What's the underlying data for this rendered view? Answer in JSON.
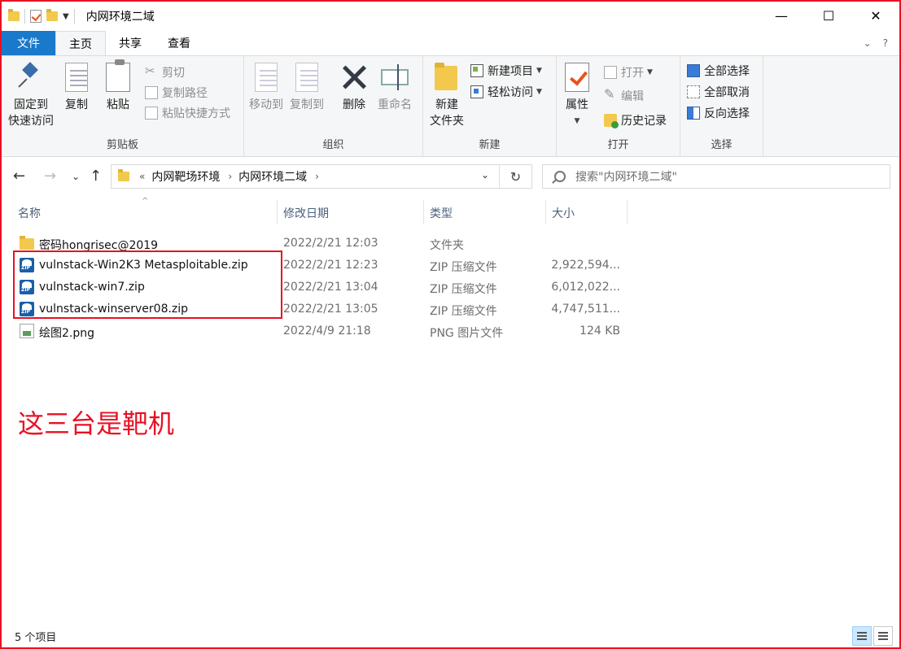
{
  "window": {
    "title": "内网环境二域",
    "minimize": "—",
    "maximize": "☐",
    "close": "✕"
  },
  "tabs": {
    "file": "文件",
    "home": "主页",
    "share": "共享",
    "view": "查看"
  },
  "ribbon": {
    "clipboard": {
      "label": "剪贴板",
      "pin": "固定到\n快速访问",
      "pin_line1": "固定到",
      "pin_line2": "快速访问",
      "copy": "复制",
      "paste": "粘贴",
      "cut": "剪切",
      "copy_path": "复制路径",
      "paste_shortcut": "粘贴快捷方式"
    },
    "organize": {
      "label": "组织",
      "move_to": "移动到",
      "copy_to": "复制到",
      "delete": "删除",
      "rename": "重命名"
    },
    "new": {
      "label": "新建",
      "new_folder_line1": "新建",
      "new_folder_line2": "文件夹",
      "new_item": "新建项目",
      "easy_access": "轻松访问"
    },
    "open": {
      "label": "打开",
      "properties": "属性",
      "open": "打开",
      "edit": "编辑",
      "history": "历史记录"
    },
    "select": {
      "label": "选择",
      "select_all": "全部选择",
      "select_none": "全部取消",
      "invert": "反向选择"
    }
  },
  "address": {
    "crumbs": [
      "内网靶场环境",
      "内网环境二域"
    ],
    "overflow": "«",
    "search_placeholder": "搜索\"内网环境二域\""
  },
  "columns": {
    "name": "名称",
    "date": "修改日期",
    "type": "类型",
    "size": "大小"
  },
  "files": [
    {
      "name": "密码hongrisec@2019",
      "date": "2022/2/21 12:03",
      "type": "文件夹",
      "size": "",
      "icon": "folder-icon"
    },
    {
      "name": "vulnstack-Win2K3 Metasploitable.zip",
      "date": "2022/2/21 12:23",
      "type": "ZIP 压缩文件",
      "size": "2,922,594...",
      "icon": "zip-icon"
    },
    {
      "name": "vulnstack-win7.zip",
      "date": "2022/2/21 13:04",
      "type": "ZIP 压缩文件",
      "size": "6,012,022...",
      "icon": "zip-icon"
    },
    {
      "name": "vulnstack-winserver08.zip",
      "date": "2022/2/21 13:05",
      "type": "ZIP 压缩文件",
      "size": "4,747,511...",
      "icon": "zip-icon"
    },
    {
      "name": "绘图2.png",
      "date": "2022/4/9 21:18",
      "type": "PNG 图片文件",
      "size": "124 KB",
      "icon": "png-icon"
    }
  ],
  "annotation": "这三台是靶机",
  "status": {
    "count": "5 个项目"
  },
  "colors": {
    "accent": "#1979ca",
    "annotation_red": "#e81123"
  }
}
